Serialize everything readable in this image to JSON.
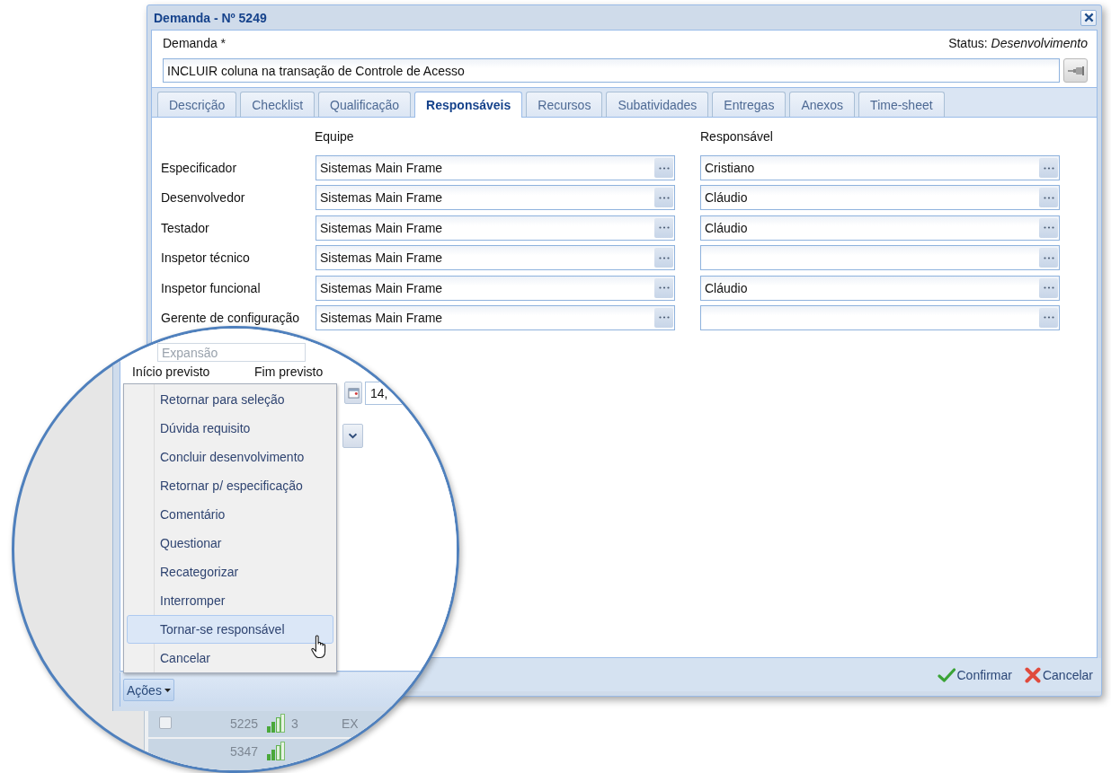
{
  "dialog": {
    "title": "Demanda - Nº 5249",
    "field_label": "Demanda *",
    "status": "Status: *Desenvolvimento*",
    "demand": "INCLUIR coluna na transação de Controle de Acesso",
    "tabs": [
      {
        "label": "Descrição",
        "selected": false
      },
      {
        "label": "Checklist",
        "selected": false
      },
      {
        "label": "Qualificação",
        "selected": false
      },
      {
        "label": "Responsáveis",
        "selected": true
      },
      {
        "label": "Recursos",
        "selected": false
      },
      {
        "label": "Subatividades",
        "selected": false
      },
      {
        "label": "Entregas",
        "selected": false
      },
      {
        "label": "Anexos",
        "selected": false
      },
      {
        "label": "Time-sheet",
        "selected": false
      }
    ],
    "columns": [
      "Equipe",
      "Responsável"
    ],
    "rows": [
      {
        "role": "Especificador",
        "team": "Sistemas Main Frame",
        "responsible": "Cristiano"
      },
      {
        "role": "Desenvolvedor",
        "team": "Sistemas Main Frame",
        "responsible": "Cláudio"
      },
      {
        "role": "Testador",
        "team": "Sistemas Main Frame",
        "responsible": "Cláudio"
      },
      {
        "role": "Inspetor técnico",
        "team": "Sistemas Main Frame"
      },
      {
        "role": "Inspetor funcional",
        "team": "Sistemas Main Frame",
        "responsible": "Cláudio"
      },
      {
        "role": "Gerente de configuração",
        "team": "Sistemas Main Frame"
      }
    ],
    "buttons": [
      {
        "kind": "confirm",
        "label": "Confirmar"
      },
      {
        "kind": "cancel",
        "label": "Cancelar"
      }
    ]
  },
  "magnifier": {
    "expansion": {
      "placeholder": "Expansão"
    },
    "date_labels": [
      "Início previsto",
      "Fim previsto"
    ],
    "value_field": "14,",
    "menu": [
      {
        "label": "Retornar para seleção",
        "highlighted": false
      },
      {
        "label": "Dúvida requisito",
        "highlighted": false
      },
      {
        "label": "Concluir desenvolvimento",
        "highlighted": false
      },
      {
        "label": "Retornar p/ especificação",
        "highlighted": false
      },
      {
        "label": "Comentário",
        "highlighted": false
      },
      {
        "label": "Questionar",
        "highlighted": false
      },
      {
        "label": "Recategorizar",
        "highlighted": false
      },
      {
        "label": "Interromper",
        "highlighted": false
      },
      {
        "label": "Tornar-se responsável",
        "highlighted": true
      },
      {
        "label": "Cancelar",
        "highlighted": false
      }
    ],
    "actions_button": "Ações",
    "grid_rows": [
      {
        "checked": false,
        "id": "5225",
        "count": "3",
        "column_3": "EX"
      },
      {
        "id": "5347"
      }
    ]
  }
}
